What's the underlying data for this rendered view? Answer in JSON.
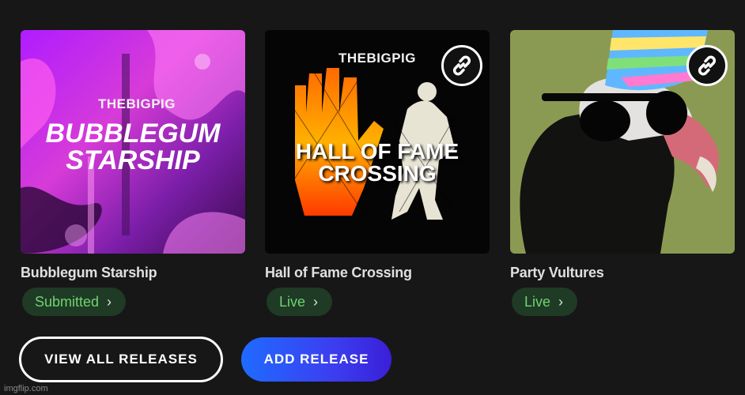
{
  "releases": [
    {
      "cover_artist": "THEBIGPIG",
      "cover_title_line1": "BUBBLEGUM",
      "cover_title_line2": "STARSHIP",
      "title": "Bubblegum Starship",
      "status": "Submitted",
      "has_link_badge": false
    },
    {
      "cover_artist": "THEBIGPIG",
      "cover_title_line1": "HALL OF FAME",
      "cover_title_line2": "CROSSING",
      "title": "Hall of Fame Crossing",
      "status": "Live",
      "has_link_badge": true
    },
    {
      "title": "Party Vultures",
      "status": "Live",
      "has_link_badge": true
    }
  ],
  "actions": {
    "view_all_label": "VIEW ALL RELEASES",
    "add_label": "ADD RELEASE"
  },
  "watermark": "imgflip.com",
  "colors": {
    "background": "#171717",
    "status_bg": "#1f3a25",
    "status_text": "#6fd36f",
    "add_button_gradient_start": "#1f6bff",
    "add_button_gradient_end": "#3a1fd8"
  },
  "icons": {
    "link_badge": "link-icon",
    "status_chevron": "chevron-right-icon"
  }
}
